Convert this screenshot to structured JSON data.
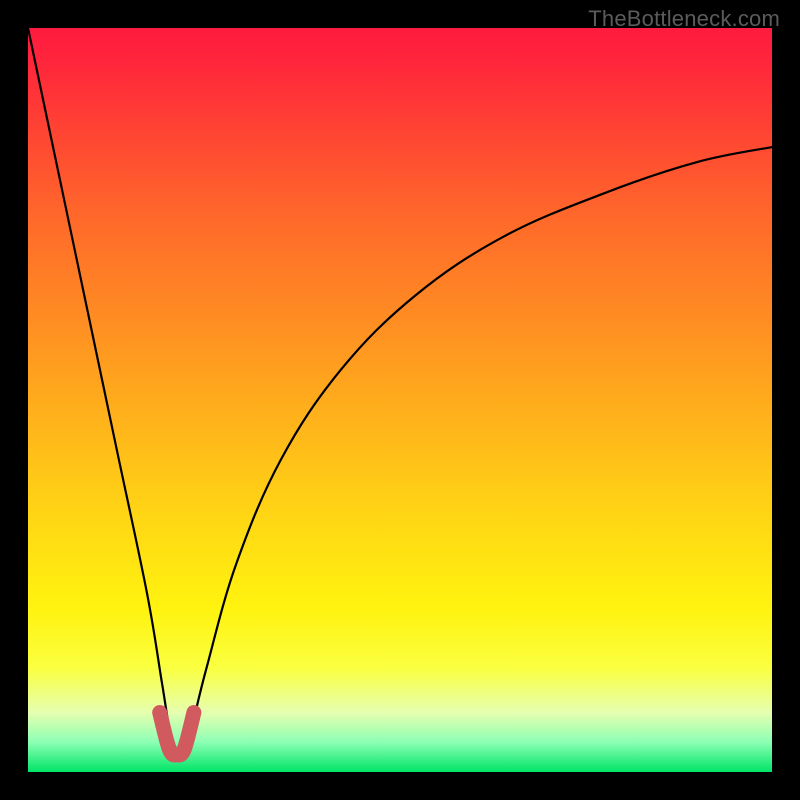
{
  "attribution": "TheBottleneck.com",
  "colors": {
    "page_bg": "#000000",
    "attribution_text": "#5b5b5b",
    "curve_stroke": "#000000",
    "marker_stroke": "#d15a5f",
    "gradient_stops": [
      {
        "offset": 0.0,
        "color": "#ff1a3f"
      },
      {
        "offset": 0.06,
        "color": "#ff2a3a"
      },
      {
        "offset": 0.14,
        "color": "#ff4433"
      },
      {
        "offset": 0.26,
        "color": "#ff6a2a"
      },
      {
        "offset": 0.4,
        "color": "#ff8f22"
      },
      {
        "offset": 0.54,
        "color": "#ffb61a"
      },
      {
        "offset": 0.66,
        "color": "#ffd714"
      },
      {
        "offset": 0.78,
        "color": "#fff30f"
      },
      {
        "offset": 0.86,
        "color": "#faff40"
      },
      {
        "offset": 0.92,
        "color": "#e6ffb0"
      },
      {
        "offset": 0.96,
        "color": "#8cffb4"
      },
      {
        "offset": 1.0,
        "color": "#00e566"
      }
    ]
  },
  "chart_data": {
    "type": "line",
    "title": "",
    "xlabel": "",
    "ylabel": "",
    "xlim": [
      0,
      100
    ],
    "ylim": [
      0,
      100
    ],
    "series": [
      {
        "name": "bottleneck-curve",
        "x": [
          0,
          4,
          8,
          12,
          16,
          18,
          19,
          20,
          21,
          22,
          24,
          28,
          34,
          42,
          52,
          64,
          78,
          90,
          100
        ],
        "y": [
          100,
          81,
          62,
          43,
          24,
          12,
          6,
          3,
          3,
          6,
          14,
          28,
          42,
          54,
          64,
          72,
          78,
          82,
          84
        ]
      }
    ],
    "highlight": {
      "name": "bottom-u-marker",
      "x": [
        17.7,
        18.7,
        19.3,
        20.0,
        20.7,
        21.3,
        22.3
      ],
      "y": [
        8.0,
        4.0,
        2.5,
        2.3,
        2.5,
        4.0,
        8.0
      ]
    }
  }
}
